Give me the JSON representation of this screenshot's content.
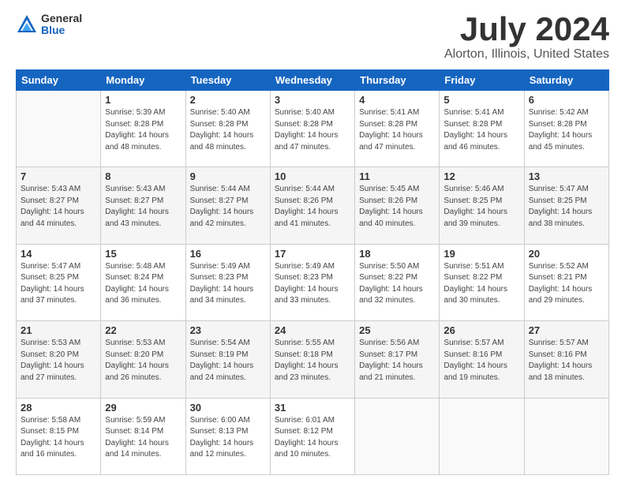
{
  "logo": {
    "general": "General",
    "blue": "Blue"
  },
  "header": {
    "title": "July 2024",
    "subtitle": "Alorton, Illinois, United States"
  },
  "weekdays": [
    "Sunday",
    "Monday",
    "Tuesday",
    "Wednesday",
    "Thursday",
    "Friday",
    "Saturday"
  ],
  "weeks": [
    [
      {
        "day": "",
        "info": ""
      },
      {
        "day": "1",
        "info": "Sunrise: 5:39 AM\nSunset: 8:28 PM\nDaylight: 14 hours\nand 48 minutes."
      },
      {
        "day": "2",
        "info": "Sunrise: 5:40 AM\nSunset: 8:28 PM\nDaylight: 14 hours\nand 48 minutes."
      },
      {
        "day": "3",
        "info": "Sunrise: 5:40 AM\nSunset: 8:28 PM\nDaylight: 14 hours\nand 47 minutes."
      },
      {
        "day": "4",
        "info": "Sunrise: 5:41 AM\nSunset: 8:28 PM\nDaylight: 14 hours\nand 47 minutes."
      },
      {
        "day": "5",
        "info": "Sunrise: 5:41 AM\nSunset: 8:28 PM\nDaylight: 14 hours\nand 46 minutes."
      },
      {
        "day": "6",
        "info": "Sunrise: 5:42 AM\nSunset: 8:28 PM\nDaylight: 14 hours\nand 45 minutes."
      }
    ],
    [
      {
        "day": "7",
        "info": "Sunrise: 5:43 AM\nSunset: 8:27 PM\nDaylight: 14 hours\nand 44 minutes."
      },
      {
        "day": "8",
        "info": "Sunrise: 5:43 AM\nSunset: 8:27 PM\nDaylight: 14 hours\nand 43 minutes."
      },
      {
        "day": "9",
        "info": "Sunrise: 5:44 AM\nSunset: 8:27 PM\nDaylight: 14 hours\nand 42 minutes."
      },
      {
        "day": "10",
        "info": "Sunrise: 5:44 AM\nSunset: 8:26 PM\nDaylight: 14 hours\nand 41 minutes."
      },
      {
        "day": "11",
        "info": "Sunrise: 5:45 AM\nSunset: 8:26 PM\nDaylight: 14 hours\nand 40 minutes."
      },
      {
        "day": "12",
        "info": "Sunrise: 5:46 AM\nSunset: 8:25 PM\nDaylight: 14 hours\nand 39 minutes."
      },
      {
        "day": "13",
        "info": "Sunrise: 5:47 AM\nSunset: 8:25 PM\nDaylight: 14 hours\nand 38 minutes."
      }
    ],
    [
      {
        "day": "14",
        "info": "Sunrise: 5:47 AM\nSunset: 8:25 PM\nDaylight: 14 hours\nand 37 minutes."
      },
      {
        "day": "15",
        "info": "Sunrise: 5:48 AM\nSunset: 8:24 PM\nDaylight: 14 hours\nand 36 minutes."
      },
      {
        "day": "16",
        "info": "Sunrise: 5:49 AM\nSunset: 8:23 PM\nDaylight: 14 hours\nand 34 minutes."
      },
      {
        "day": "17",
        "info": "Sunrise: 5:49 AM\nSunset: 8:23 PM\nDaylight: 14 hours\nand 33 minutes."
      },
      {
        "day": "18",
        "info": "Sunrise: 5:50 AM\nSunset: 8:22 PM\nDaylight: 14 hours\nand 32 minutes."
      },
      {
        "day": "19",
        "info": "Sunrise: 5:51 AM\nSunset: 8:22 PM\nDaylight: 14 hours\nand 30 minutes."
      },
      {
        "day": "20",
        "info": "Sunrise: 5:52 AM\nSunset: 8:21 PM\nDaylight: 14 hours\nand 29 minutes."
      }
    ],
    [
      {
        "day": "21",
        "info": "Sunrise: 5:53 AM\nSunset: 8:20 PM\nDaylight: 14 hours\nand 27 minutes."
      },
      {
        "day": "22",
        "info": "Sunrise: 5:53 AM\nSunset: 8:20 PM\nDaylight: 14 hours\nand 26 minutes."
      },
      {
        "day": "23",
        "info": "Sunrise: 5:54 AM\nSunset: 8:19 PM\nDaylight: 14 hours\nand 24 minutes."
      },
      {
        "day": "24",
        "info": "Sunrise: 5:55 AM\nSunset: 8:18 PM\nDaylight: 14 hours\nand 23 minutes."
      },
      {
        "day": "25",
        "info": "Sunrise: 5:56 AM\nSunset: 8:17 PM\nDaylight: 14 hours\nand 21 minutes."
      },
      {
        "day": "26",
        "info": "Sunrise: 5:57 AM\nSunset: 8:16 PM\nDaylight: 14 hours\nand 19 minutes."
      },
      {
        "day": "27",
        "info": "Sunrise: 5:57 AM\nSunset: 8:16 PM\nDaylight: 14 hours\nand 18 minutes."
      }
    ],
    [
      {
        "day": "28",
        "info": "Sunrise: 5:58 AM\nSunset: 8:15 PM\nDaylight: 14 hours\nand 16 minutes."
      },
      {
        "day": "29",
        "info": "Sunrise: 5:59 AM\nSunset: 8:14 PM\nDaylight: 14 hours\nand 14 minutes."
      },
      {
        "day": "30",
        "info": "Sunrise: 6:00 AM\nSunset: 8:13 PM\nDaylight: 14 hours\nand 12 minutes."
      },
      {
        "day": "31",
        "info": "Sunrise: 6:01 AM\nSunset: 8:12 PM\nDaylight: 14 hours\nand 10 minutes."
      },
      {
        "day": "",
        "info": ""
      },
      {
        "day": "",
        "info": ""
      },
      {
        "day": "",
        "info": ""
      }
    ]
  ]
}
